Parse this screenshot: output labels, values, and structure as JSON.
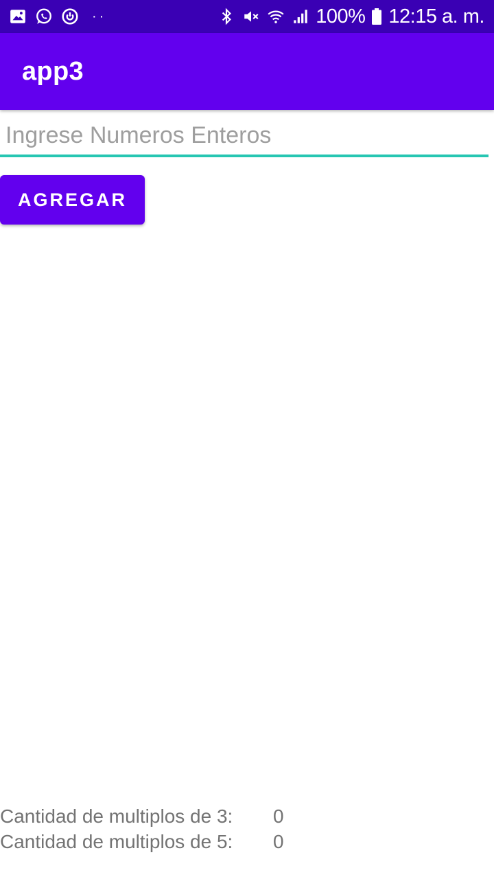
{
  "status_bar": {
    "left_icons": [
      "image-icon",
      "whatsapp-icon",
      "power-ring-icon"
    ],
    "dots": "··",
    "right_icons": [
      "bluetooth-icon",
      "mute-icon",
      "wifi-icon",
      "signal-icon",
      "battery-icon"
    ],
    "battery": "100%",
    "time": "12:15 a. m."
  },
  "app_bar": {
    "title": "app3"
  },
  "form": {
    "input_value": "",
    "input_placeholder": "Ingrese Numeros Enteros",
    "add_button_label": "AGREGAR"
  },
  "results": [
    {
      "label": "Cantidad de multiplos de 3:",
      "value": "0"
    },
    {
      "label": "Cantidad de multiplos de 5:",
      "value": "0"
    }
  ],
  "colors": {
    "status_bar": "#3a00b4",
    "primary": "#6200ee",
    "accent_underline": "#26c6b2",
    "result_text": "#737373"
  }
}
